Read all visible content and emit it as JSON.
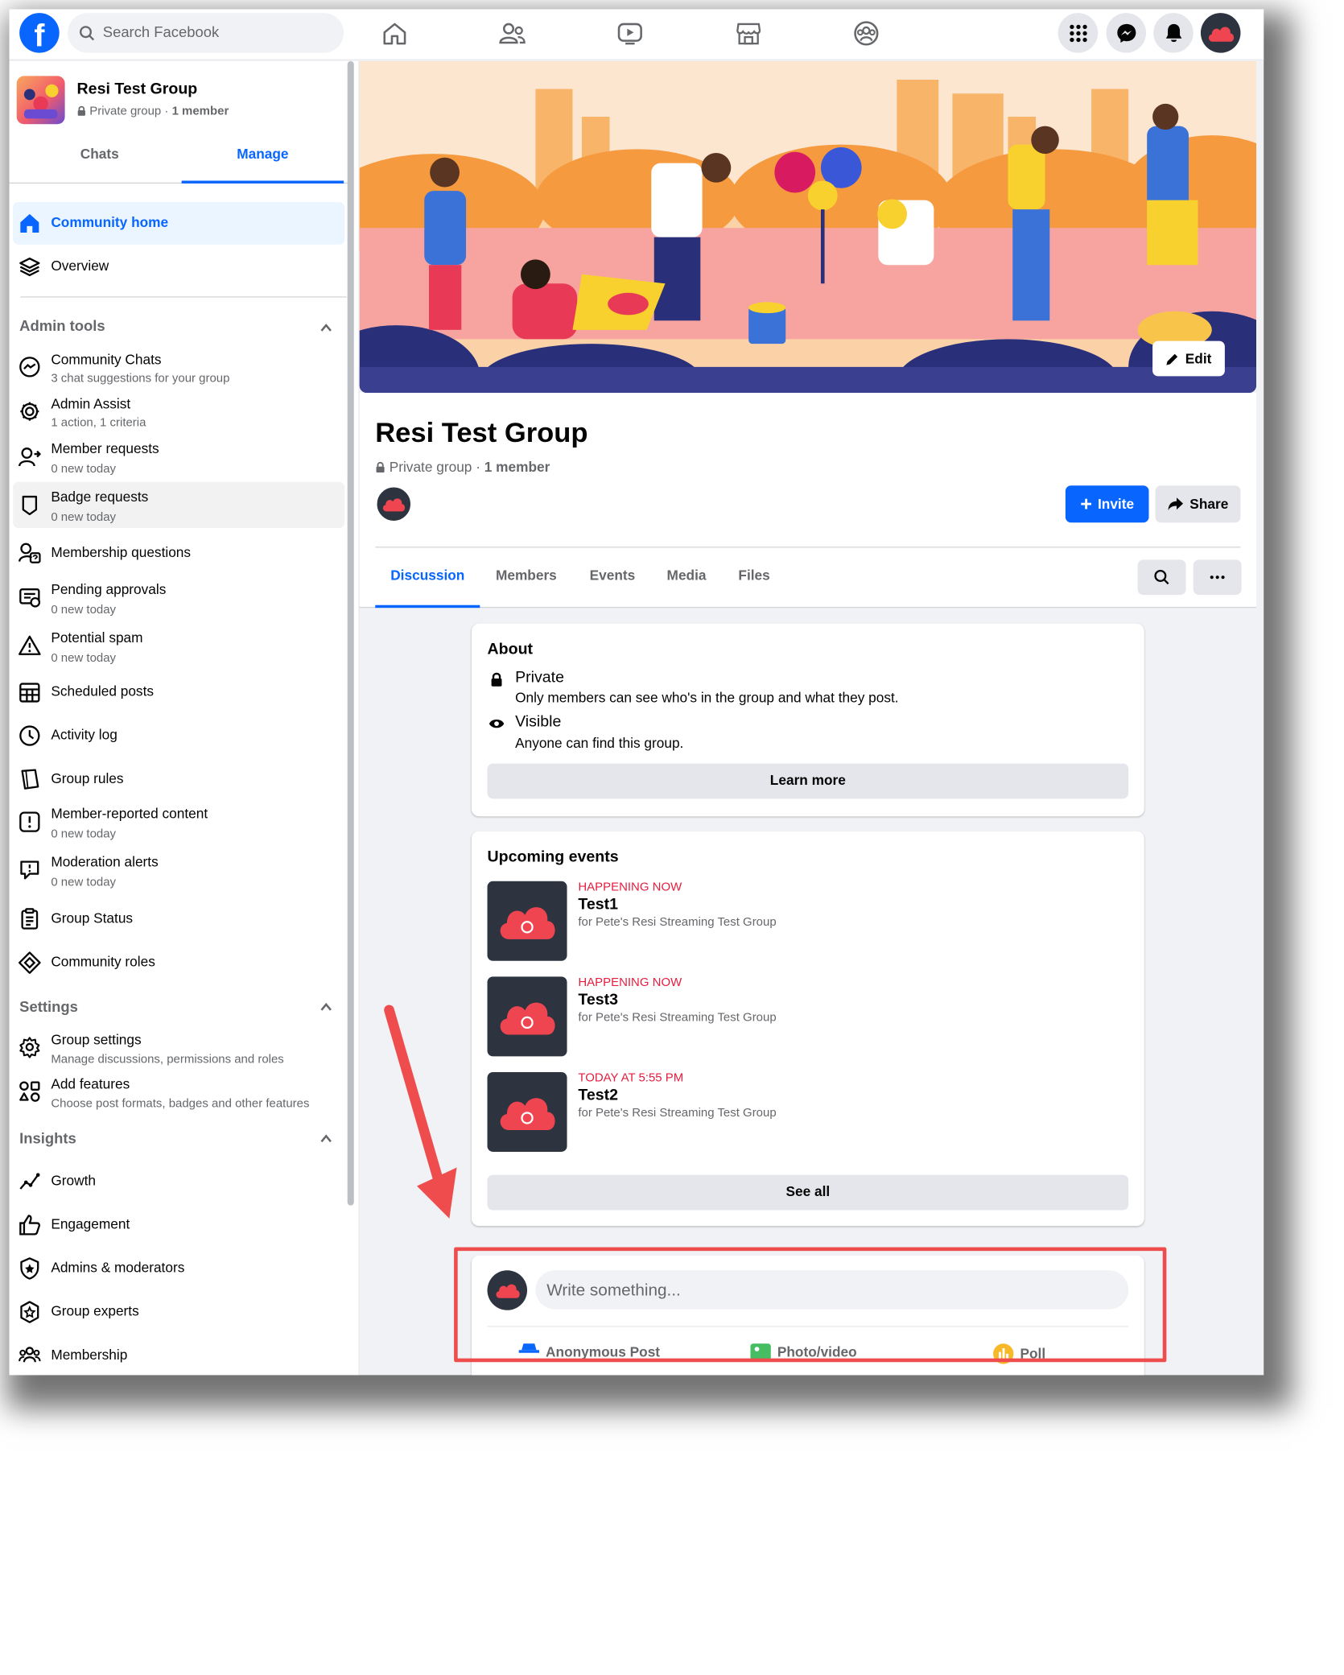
{
  "topbar": {
    "search_placeholder": "Search Facebook",
    "nav": [
      "home-icon",
      "friends-icon",
      "watch-icon",
      "marketplace-icon",
      "groups-icon"
    ],
    "right_buttons": [
      "menu-grid-icon",
      "messenger-icon",
      "notifications-icon"
    ]
  },
  "sidebar": {
    "group_name": "Resi Test Group",
    "group_privacy": "Private group",
    "group_members": "1 member",
    "tabs": [
      "Chats",
      "Manage"
    ],
    "items_top": [
      {
        "label": "Community home"
      },
      {
        "label": "Overview"
      }
    ],
    "admin_tools_title": "Admin tools",
    "admin_tools": [
      {
        "label": "Community Chats",
        "sub": "3 chat suggestions for your group"
      },
      {
        "label": "Admin Assist",
        "sub": "1 action, 1 criteria"
      },
      {
        "label": "Member requests",
        "sub": "0 new today"
      },
      {
        "label": "Badge requests",
        "sub": "0 new today"
      },
      {
        "label": "Membership questions",
        "sub": ""
      },
      {
        "label": "Pending approvals",
        "sub": "0 new today"
      },
      {
        "label": "Potential spam",
        "sub": "0 new today"
      },
      {
        "label": "Scheduled posts",
        "sub": ""
      },
      {
        "label": "Activity log",
        "sub": ""
      },
      {
        "label": "Group rules",
        "sub": ""
      },
      {
        "label": "Member-reported content",
        "sub": "0 new today"
      },
      {
        "label": "Moderation alerts",
        "sub": "0 new today"
      },
      {
        "label": "Group Status",
        "sub": ""
      },
      {
        "label": "Community roles",
        "sub": ""
      }
    ],
    "settings_title": "Settings",
    "settings": [
      {
        "label": "Group settings",
        "sub": "Manage discussions, permissions and roles"
      },
      {
        "label": "Add features",
        "sub": "Choose post formats, badges and other features"
      }
    ],
    "insights_title": "Insights",
    "insights": [
      {
        "label": "Growth"
      },
      {
        "label": "Engagement"
      },
      {
        "label": "Admins & moderators"
      },
      {
        "label": "Group experts"
      },
      {
        "label": "Membership"
      }
    ]
  },
  "header": {
    "edit_label": "Edit",
    "title": "Resi Test Group",
    "privacy": "Private group",
    "members": "1 member",
    "invite_label": "Invite",
    "share_label": "Share",
    "tabs": [
      "Discussion",
      "Members",
      "Events",
      "Media",
      "Files"
    ]
  },
  "about": {
    "title": "About",
    "private_title": "Private",
    "private_desc": "Only members can see who's in the group and what they post.",
    "visible_title": "Visible",
    "visible_desc": "Anyone can find this group.",
    "learn_more": "Learn more"
  },
  "events": {
    "title": "Upcoming events",
    "items": [
      {
        "when": "HAPPENING NOW",
        "name": "Test1",
        "sub": "for Pete's Resi Streaming Test Group"
      },
      {
        "when": "HAPPENING NOW",
        "name": "Test3",
        "sub": "for Pete's Resi Streaming Test Group"
      },
      {
        "when": "TODAY AT 5:55 PM",
        "name": "Test2",
        "sub": "for Pete's Resi Streaming Test Group"
      }
    ],
    "see_all": "See all"
  },
  "composer": {
    "placeholder": "Write something...",
    "actions": [
      "Anonymous Post",
      "Photo/video",
      "Poll"
    ]
  },
  "colors": {
    "accent": "#0866ff",
    "annotation": "#ef4d4d",
    "event_when": "#e41e3f"
  }
}
